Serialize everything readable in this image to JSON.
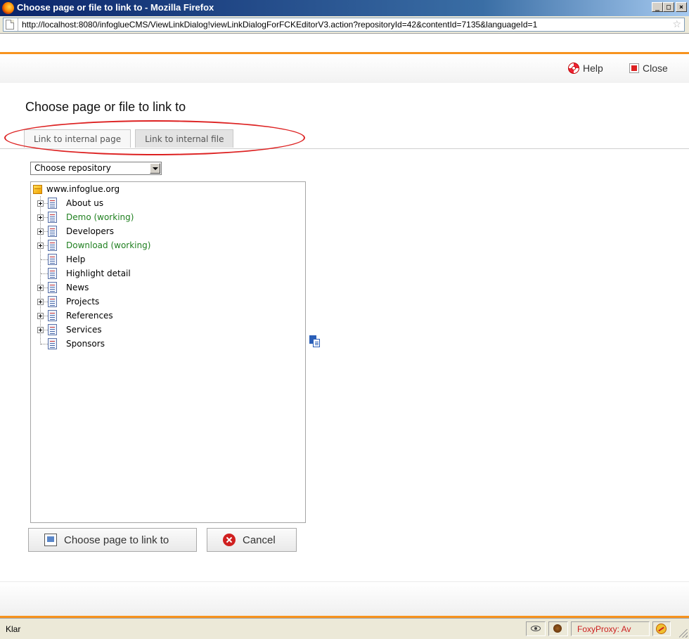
{
  "window": {
    "title": "Choose page or file to link to - Mozilla Firefox",
    "buttons": {
      "minimize": "_",
      "maximize": "□",
      "close": "×"
    }
  },
  "urlbar": {
    "url": "http://localhost:8080/infoglueCMS/ViewLinkDialog!viewLinkDialogForFCKEditorV3.action?repositoryId=42&contentId=7135&languageId=1",
    "bookmark_glyph": "☆"
  },
  "toolbar": {
    "help_label": "Help",
    "close_label": "Close"
  },
  "dialog": {
    "heading": "Choose page or file to link to",
    "tabs": [
      {
        "label": "Link to internal page",
        "active": true
      },
      {
        "label": "Link to internal file",
        "active": false
      }
    ],
    "repository_select": {
      "value": "Choose repository"
    },
    "tree": {
      "root": "www.infoglue.org",
      "nodes": [
        {
          "label": "About us",
          "expandable": true,
          "working": false
        },
        {
          "label": "Demo (working)",
          "expandable": true,
          "working": true
        },
        {
          "label": "Developers",
          "expandable": true,
          "working": false
        },
        {
          "label": "Download (working)",
          "expandable": true,
          "working": true
        },
        {
          "label": "Help",
          "expandable": false,
          "working": false
        },
        {
          "label": "Highlight detail",
          "expandable": false,
          "working": false
        },
        {
          "label": "News",
          "expandable": true,
          "working": false
        },
        {
          "label": "Projects",
          "expandable": true,
          "working": false
        },
        {
          "label": "References",
          "expandable": true,
          "working": false
        },
        {
          "label": "Services",
          "expandable": true,
          "working": false
        },
        {
          "label": "Sponsors",
          "expandable": false,
          "working": false
        }
      ]
    },
    "choose_button": "Choose page to link to",
    "cancel_button": "Cancel"
  },
  "statusbar": {
    "status": "Klar",
    "proxy": "FoxyProxy: Av"
  },
  "colors": {
    "accent_orange": "#f7931e",
    "working_green": "#208020",
    "annotation_red": "#dd2222"
  }
}
